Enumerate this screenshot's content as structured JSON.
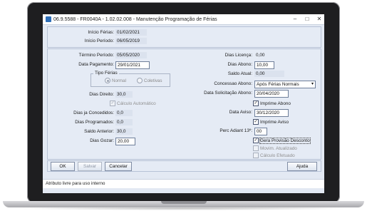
{
  "window": {
    "title": "06.9.5588 - FR0040A - 1.02.02.008 - Manutenção Programação de Férias",
    "controls": [
      "–",
      "□",
      "✕"
    ]
  },
  "top": {
    "inicio_ferias_label": "Início Férias:",
    "inicio_ferias_value": "01/02/2021",
    "inicio_periodo_label": "Início Período:",
    "inicio_periodo_value": "06/05/2019"
  },
  "left": {
    "termino_periodo_label": "Término Período:",
    "termino_periodo_value": "05/05/2020",
    "data_pagamento_label": "Data Pagamento:",
    "data_pagamento_value": "29/01/2021",
    "tipo_ferias_title": "Tipo Férias",
    "tipo_normal": "Normal",
    "tipo_coletivas": "Coletivas",
    "dias_direito_label": "Dias Direito:",
    "dias_direito_value": "30,0",
    "calculo_automatico": "Cálculo Automático",
    "dias_ja_concedidos_label": "Dias ja Concedidos:",
    "dias_ja_concedidos_value": "0,0",
    "dias_programados_label": "Dias Programados:",
    "dias_programados_value": "0,0",
    "saldo_anterior_label": "Saldo Anterior:",
    "saldo_anterior_value": "30,0",
    "dias_gozar_label": "Dias Gozar:",
    "dias_gozar_value": "20,00"
  },
  "right": {
    "dias_licenca_label": "Dias Licença:",
    "dias_licenca_value": "0,00",
    "dias_abono_label": "Dias Abono:",
    "dias_abono_value": "10,00",
    "saldo_atual_label": "Saldo Atual:",
    "saldo_atual_value": "0,00",
    "concessao_abono_label": "Concessao Abono:",
    "concessao_abono_value": "Após Férias Normais",
    "data_solicitacao_label": "Data Solicitação Abono:",
    "data_solicitacao_value": "20/04/2020",
    "imprime_abono": "Imprime Abono",
    "data_aviso_label": "Data Aviso:",
    "data_aviso_value": "30/12/2020",
    "imprime_aviso": "Imprime Aviso",
    "perc_adiant_label": "Perc Adiant 13º:",
    "perc_adiant_value": "00",
    "gera_provisao": "Gera Provisão Desconto",
    "movim_atualizado": "Movim. Atualizado",
    "calculo_efetuado": "Cálculo Efetuado",
    "check_mark": "✓"
  },
  "buttons": {
    "ok": "OK",
    "salvar": "Salvar",
    "cancelar": "Cancelar",
    "ajuda": "Ajuda"
  },
  "status": {
    "text": "Atributo livre para uso interno"
  }
}
